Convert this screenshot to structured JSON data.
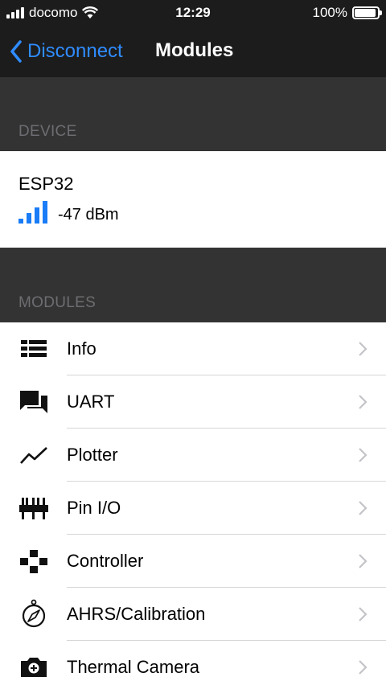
{
  "status_bar": {
    "carrier": "docomo",
    "time": "12:29",
    "battery": "100%",
    "battery_level": 1.0
  },
  "nav": {
    "back_label": "Disconnect",
    "title": "Modules"
  },
  "device_section": {
    "header": "DEVICE",
    "device_name": "ESP32",
    "rssi": "-47 dBm",
    "signal_strength_of_4": 4
  },
  "modules_section": {
    "header": "MODULES",
    "items": [
      {
        "label": "Info",
        "icon": "list-icon"
      },
      {
        "label": "UART",
        "icon": "chat-icon"
      },
      {
        "label": "Plotter",
        "icon": "line-chart-icon"
      },
      {
        "label": "Pin I/O",
        "icon": "pins-icon"
      },
      {
        "label": "Controller",
        "icon": "gamepad-icon"
      },
      {
        "label": "AHRS/Calibration",
        "icon": "compass-icon"
      },
      {
        "label": "Thermal Camera",
        "icon": "camera-icon"
      }
    ]
  },
  "colors": {
    "accent": "#2f8cff",
    "signal": "#1a7cf7",
    "nav_background": "#1c1c1c",
    "section_background": "#333333",
    "section_text": "#6d6d72"
  }
}
